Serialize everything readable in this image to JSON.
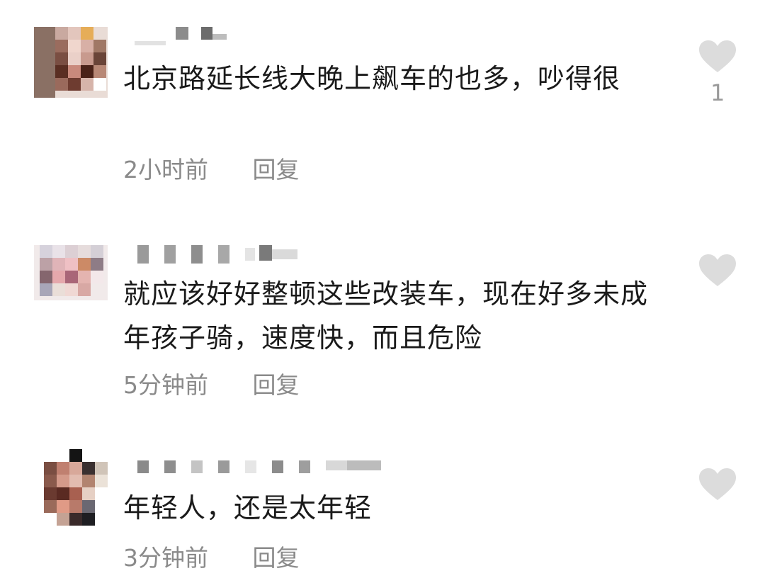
{
  "comments": [
    {
      "username": "",
      "text": "北京路延长线大晚上飙车的也多，吵得很",
      "time": "2小时前",
      "reply_label": "回复",
      "like_count": "1"
    },
    {
      "username": "",
      "text": "就应该好好整顿这些改装车，现在好多未成年孩子骑，速度快，而且危险",
      "time": "5分钟前",
      "reply_label": "回复",
      "like_count": ""
    },
    {
      "username": "",
      "text": "年轻人，还是太年轻",
      "time": "3分钟前",
      "reply_label": "回复",
      "like_count": ""
    }
  ],
  "icons": {
    "like": "heart-icon"
  },
  "colors": {
    "text": "#1a1a1a",
    "meta": "#8a8a8a",
    "heart": "#dcdcdc"
  }
}
